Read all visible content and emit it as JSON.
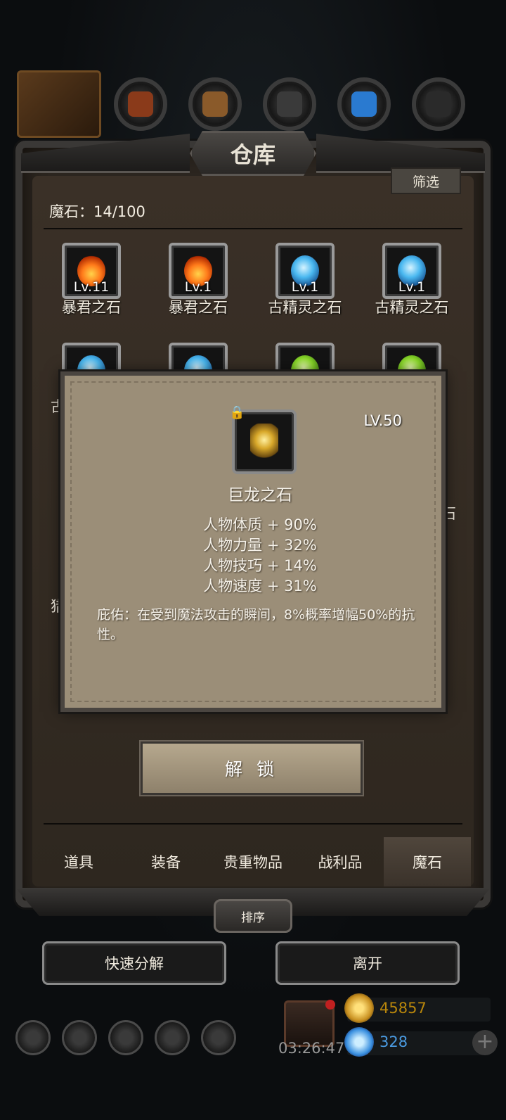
{
  "header": {
    "title": "仓库",
    "filter_label": "筛选",
    "count_label": "魔石：14/100"
  },
  "grid": {
    "items": [
      {
        "name": "暴君之石",
        "level": "Lv.11",
        "gem": "fire"
      },
      {
        "name": "暴君之石",
        "level": "Lv.1",
        "gem": "fire"
      },
      {
        "name": "古精灵之石",
        "level": "Lv.1",
        "gem": "ice"
      },
      {
        "name": "古精灵之石",
        "level": "Lv.1",
        "gem": "ice"
      }
    ],
    "partial_left_1": "古",
    "partial_left_2": "猎",
    "partial_right": "石"
  },
  "popup": {
    "title": "巨龙之石",
    "level": "LV.50",
    "stats": [
      "人物体质 + 90%",
      "人物力量 + 32%",
      "人物技巧 + 14%",
      "人物速度 + 31%"
    ],
    "description": "庇佑：在受到魔法攻击的瞬间，8%概率增幅50%的抗性。",
    "icon": "lock-icon"
  },
  "unlock_label": "解 锁",
  "tabs": [
    {
      "label": "道具",
      "active": false
    },
    {
      "label": "装备",
      "active": false
    },
    {
      "label": "贵重物品",
      "active": false
    },
    {
      "label": "战利品",
      "active": false
    },
    {
      "label": "魔石",
      "active": true
    }
  ],
  "sort_label": "排序",
  "actions": {
    "decompose_label": "快速分解",
    "leave_label": "离开"
  },
  "hud": {
    "timer": "03:26:47",
    "gold": "45857",
    "gems": "328",
    "gold_color": "#b8860b",
    "gem_color": "#4a9ae0"
  }
}
